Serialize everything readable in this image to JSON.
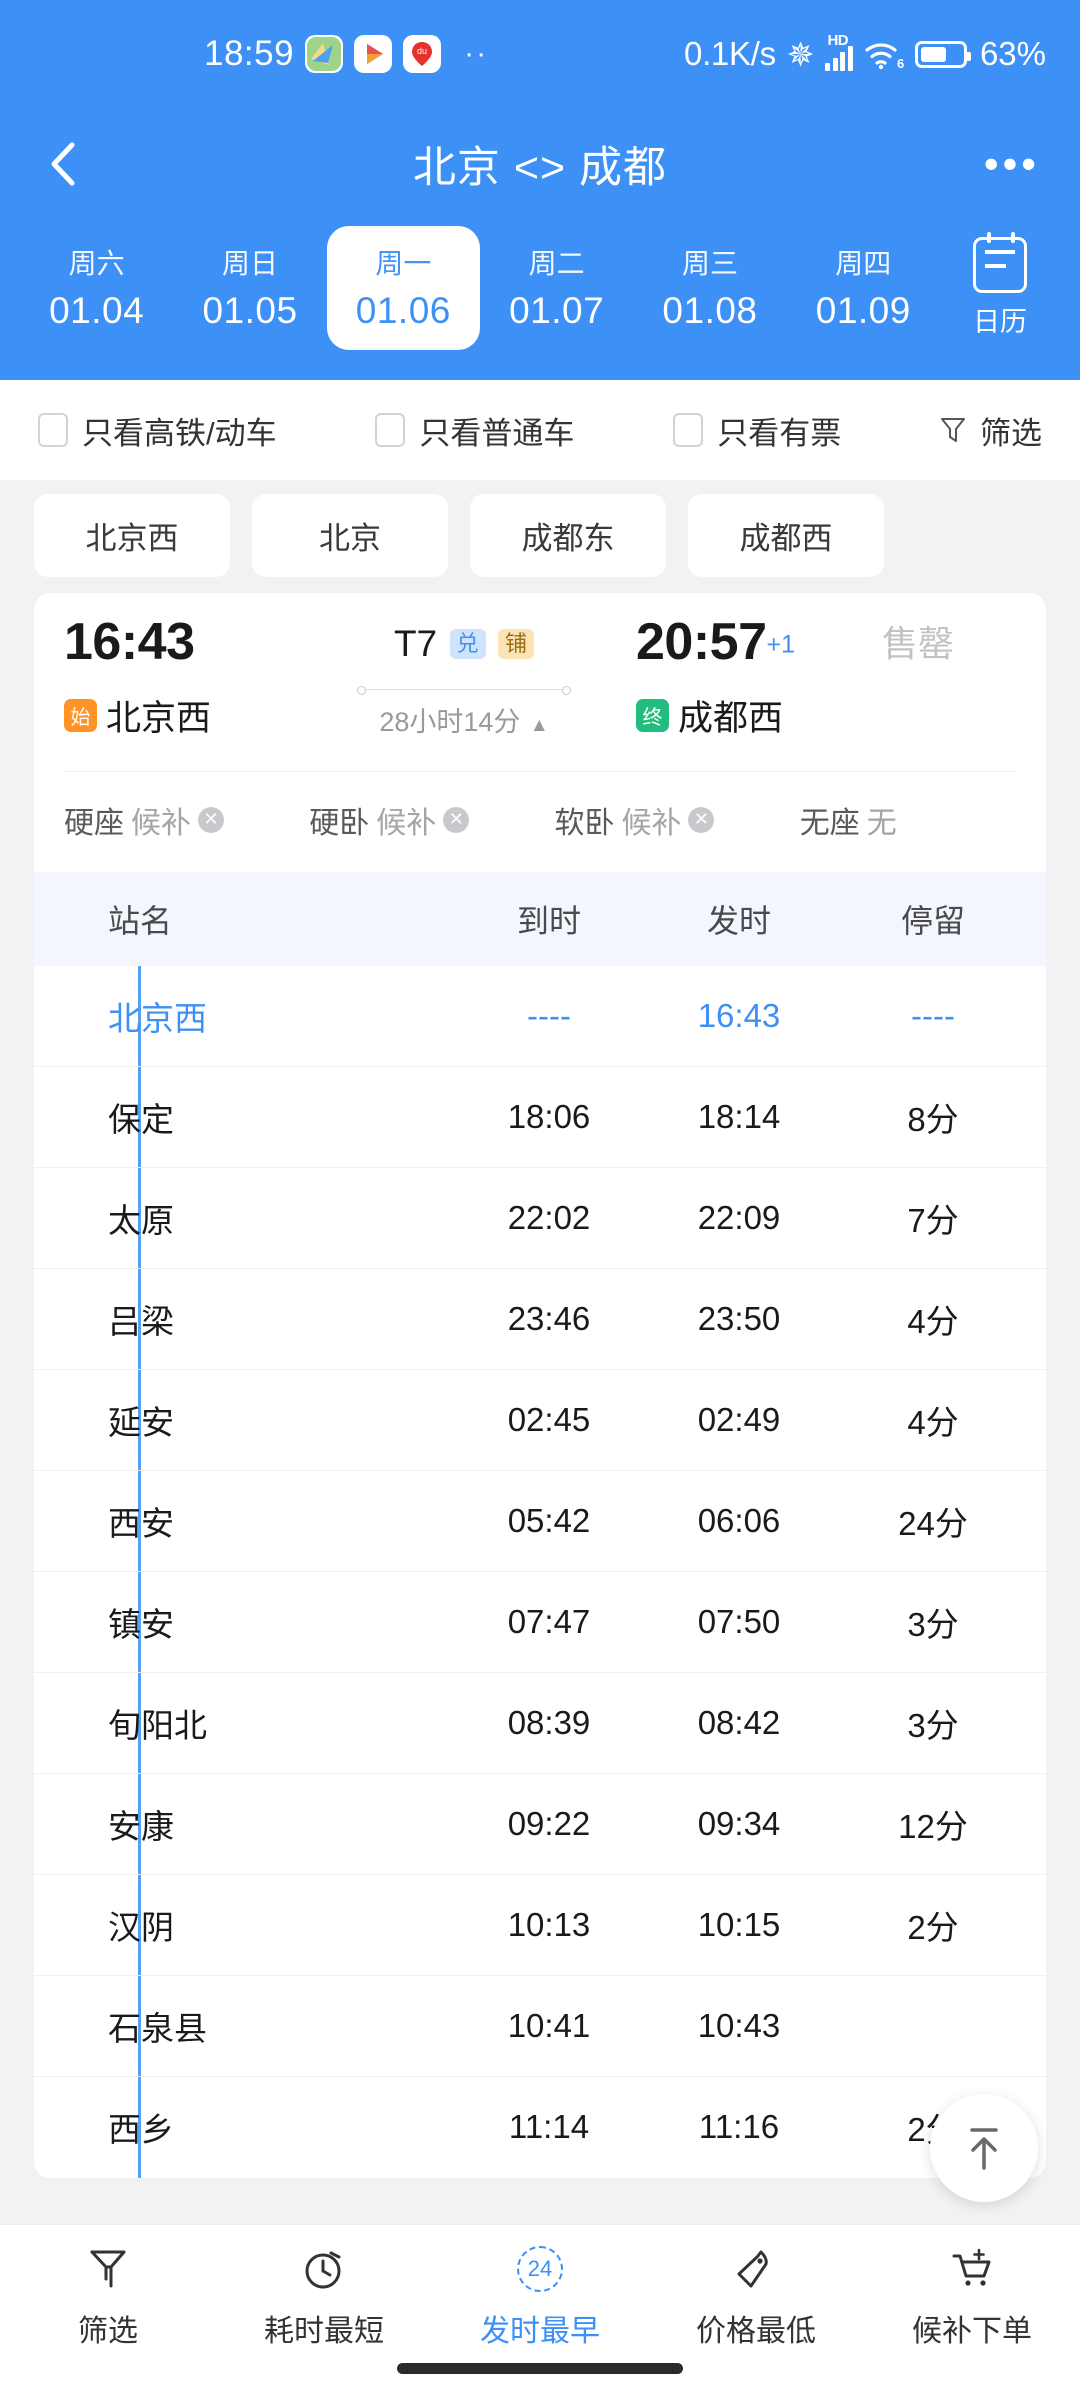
{
  "statusbar": {
    "time": "18:59",
    "dots": "··",
    "network_speed": "0.1K/s",
    "hd_label": "HD",
    "wifi_gen": "6",
    "battery_text": "63%",
    "battery_level": 63,
    "icons": [
      "map-app-icon",
      "media-app-icon",
      "baidu-app-icon",
      "bluetooth-icon",
      "signal-bars-icon",
      "wifi-icon",
      "battery-icon"
    ]
  },
  "header": {
    "title": "北京 <> 成都",
    "back_icon": "chevron-left-icon",
    "more_icon": "more-options-icon",
    "accent": "#3d90f5"
  },
  "dates": {
    "items": [
      {
        "dow": "周六",
        "date": "01.04",
        "active": false
      },
      {
        "dow": "周日",
        "date": "01.05",
        "active": false
      },
      {
        "dow": "周一",
        "date": "01.06",
        "active": true
      },
      {
        "dow": "周二",
        "date": "01.07",
        "active": false
      },
      {
        "dow": "周三",
        "date": "01.08",
        "active": false
      },
      {
        "dow": "周四",
        "date": "01.09",
        "active": false
      }
    ],
    "calendar_label": "日历"
  },
  "filters": {
    "items": [
      {
        "label": "只看高铁/动车",
        "checked": false
      },
      {
        "label": "只看普通车",
        "checked": false
      },
      {
        "label": "只看有票",
        "checked": false
      }
    ],
    "filter_label": "筛选"
  },
  "station_chips": [
    "北京西",
    "北京",
    "成都东",
    "成都西"
  ],
  "train": {
    "depart_time": "16:43",
    "depart_station": "北京西",
    "depart_badge": "始",
    "train_no": "T7",
    "tags": [
      "兑",
      "铺"
    ],
    "duration": "28小时14分",
    "arrive_time": "20:57",
    "arrive_day_offset": "+1",
    "arrive_station": "成都西",
    "arrive_badge": "终",
    "status": "售罄",
    "seats": [
      {
        "name": "硬座",
        "state": "候补",
        "closable": true
      },
      {
        "name": "硬卧",
        "state": "候补",
        "closable": true
      },
      {
        "name": "软卧",
        "state": "候补",
        "closable": true
      },
      {
        "name": "无座",
        "state": "无",
        "closable": false
      }
    ]
  },
  "stops_table": {
    "columns": [
      "站名",
      "到时",
      "发时",
      "停留"
    ],
    "rows": [
      {
        "name": "北京西",
        "arrive": "----",
        "depart": "16:43",
        "stay": "----",
        "first": true
      },
      {
        "name": "保定",
        "arrive": "18:06",
        "depart": "18:14",
        "stay": "8分"
      },
      {
        "name": "太原",
        "arrive": "22:02",
        "depart": "22:09",
        "stay": "7分"
      },
      {
        "name": "吕梁",
        "arrive": "23:46",
        "depart": "23:50",
        "stay": "4分"
      },
      {
        "name": "延安",
        "arrive": "02:45",
        "depart": "02:49",
        "stay": "4分"
      },
      {
        "name": "西安",
        "arrive": "05:42",
        "depart": "06:06",
        "stay": "24分"
      },
      {
        "name": "镇安",
        "arrive": "07:47",
        "depart": "07:50",
        "stay": "3分"
      },
      {
        "name": "旬阳北",
        "arrive": "08:39",
        "depart": "08:42",
        "stay": "3分"
      },
      {
        "name": "安康",
        "arrive": "09:22",
        "depart": "09:34",
        "stay": "12分"
      },
      {
        "name": "汉阴",
        "arrive": "10:13",
        "depart": "10:15",
        "stay": "2分"
      },
      {
        "name": "石泉县",
        "arrive": "10:41",
        "depart": "10:43",
        "stay": ""
      },
      {
        "name": "西乡",
        "arrive": "11:14",
        "depart": "11:16",
        "stay": "2分"
      }
    ]
  },
  "fab": {
    "icon": "scroll-to-top-icon"
  },
  "bottomnav": {
    "items": [
      {
        "label": "筛选",
        "icon": "funnel-icon",
        "active": false,
        "badge": ""
      },
      {
        "label": "耗时最短",
        "icon": "stopwatch-icon",
        "active": false,
        "badge": ""
      },
      {
        "label": "发时最早",
        "icon": "clock-24-icon",
        "active": true,
        "badge": "24"
      },
      {
        "label": "价格最低",
        "icon": "price-tag-icon",
        "active": false,
        "badge": ""
      },
      {
        "label": "候补下单",
        "icon": "cart-plus-icon",
        "active": false,
        "badge": ""
      }
    ]
  }
}
